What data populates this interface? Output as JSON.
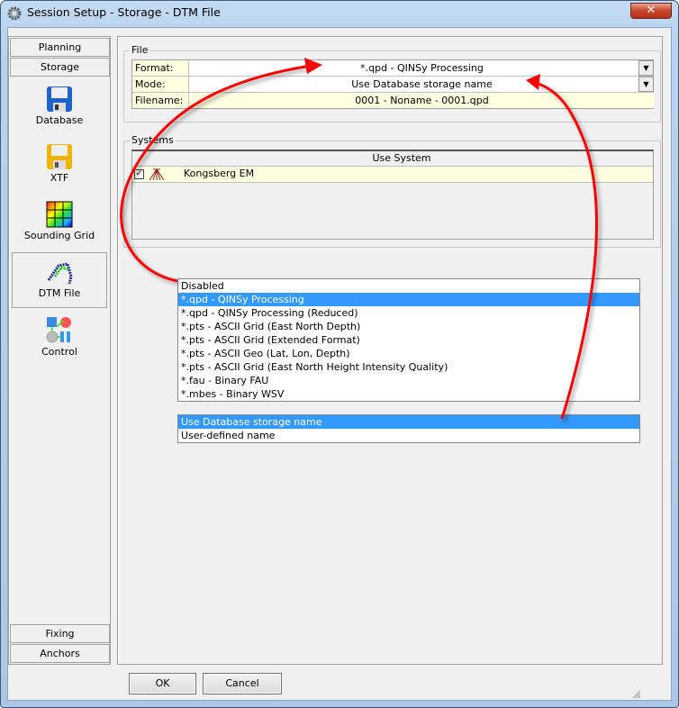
{
  "window": {
    "title": "Session Setup - Storage -  DTM File",
    "close_icon": "close-icon"
  },
  "sidebar": {
    "top_buttons": [
      {
        "label": "Planning"
      },
      {
        "label": "Storage"
      }
    ],
    "items": [
      {
        "label": "Database",
        "icon": "floppy-blue-icon"
      },
      {
        "label": "XTF",
        "icon": "floppy-yellow-icon"
      },
      {
        "label": "Sounding Grid",
        "icon": "color-grid-icon"
      },
      {
        "label": "DTM File",
        "icon": "dtm-icon",
        "selected": true
      },
      {
        "label": "Control",
        "icon": "control-icon"
      }
    ],
    "bottom_buttons": [
      {
        "label": "Fixing"
      },
      {
        "label": "Anchors"
      }
    ]
  },
  "file": {
    "group_label": "File",
    "rows": [
      {
        "label": "Format:",
        "value": "*.qpd - QINSy Processing",
        "dropdown": true
      },
      {
        "label": "Mode:",
        "value": "Use Database storage name",
        "dropdown": true
      },
      {
        "label": "Filename:",
        "value": "0001 - Noname - 0001.qpd",
        "dropdown": false
      }
    ]
  },
  "systems": {
    "group_label": "Systems",
    "column_header": "Use System",
    "rows": [
      {
        "checked": true,
        "icon": "multibeam-icon",
        "name": "Kongsberg EM"
      }
    ]
  },
  "format_options": {
    "selected_index": 1,
    "items": [
      "Disabled",
      "*.qpd - QINSy Processing",
      "*.qpd - QINSy Processing (Reduced)",
      "*.pts - ASCII Grid (East North Depth)",
      "*.pts - ASCII Grid (Extended Format)",
      "*.pts - ASCII Geo  (Lat, Lon,  Depth)",
      "*.pts - ASCII Grid (East North Height Intensity Quality)",
      "*.fau - Binary FAU",
      "*.mbes - Binary WSV"
    ]
  },
  "mode_options": {
    "selected_index": 0,
    "items": [
      "Use Database storage name",
      "User-defined name"
    ]
  },
  "buttons": {
    "ok": "OK",
    "cancel": "Cancel"
  },
  "colors": {
    "selection": "#3399ff",
    "label_bg": "#ffffe1",
    "annotation_arrow": "#ff0000"
  }
}
